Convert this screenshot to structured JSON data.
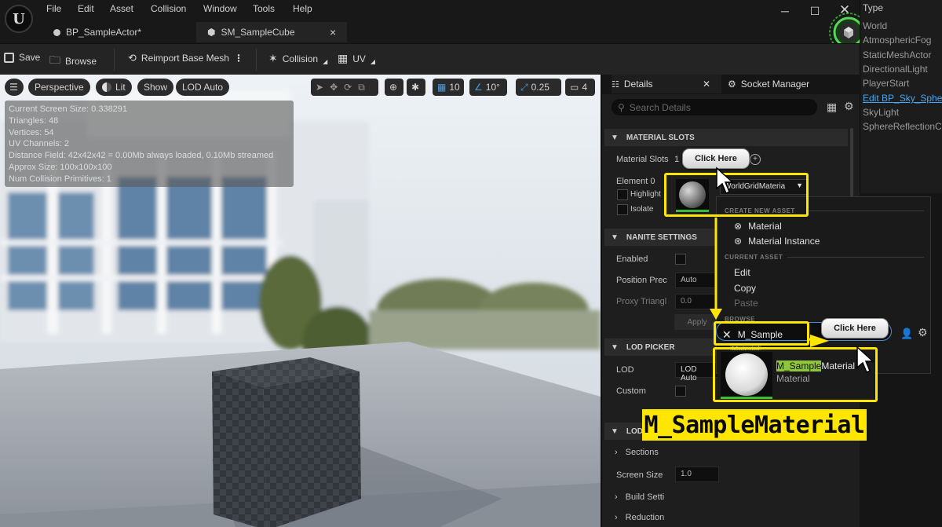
{
  "app": {
    "menu": [
      "File",
      "Edit",
      "Asset",
      "Collision",
      "Window",
      "Tools",
      "Help"
    ],
    "tabs": [
      {
        "label": "BP_SampleActor*"
      },
      {
        "label": "SM_SampleCube"
      }
    ],
    "tab_close": "×"
  },
  "toolbar": {
    "save": "Save",
    "browse": "Browse",
    "reimport": "Reimport Base Mesh",
    "collision": "Collision",
    "uv": "UV"
  },
  "viewport": {
    "perspective": "Perspective",
    "lit": "Lit",
    "show": "Show",
    "lod": "LOD Auto",
    "grid_snap": "10",
    "rot_snap": "10°",
    "scale_snap": "0.25",
    "cam_speed": "4",
    "stats": [
      "Current Screen Size: 0.338291",
      "Triangles: 48",
      "Vertices: 54",
      "UV Channels: 2",
      "Distance Field: 42x42x42 = 0.00Mb always loaded, 0.10Mb streamed",
      "Approx Size: 100x100x100",
      "Num Collision Primitives: 1"
    ]
  },
  "outliner": {
    "header": "Type",
    "items": [
      "World",
      "AtmosphericFog",
      "StaticMeshActor",
      "DirectionalLight",
      "PlayerStart",
      "Edit BP_Sky_Sphere",
      "SkyLight",
      "SphereReflectionCa"
    ]
  },
  "details": {
    "tab_details": "Details",
    "tab_socket": "Socket Manager",
    "search_placeholder": "Search Details",
    "material_slots_header": "MATERIAL SLOTS",
    "material_slots_label": "Material Slots",
    "material_slots_value": "1 M",
    "element0": "Element 0",
    "highlight": "Highlight",
    "isolate": "Isolate",
    "material_name": "WorldGridMateria",
    "nanite_header": "NANITE SETTINGS",
    "enabled": "Enabled",
    "position_prec": "Position Prec",
    "position_prec_value": "Auto",
    "proxy_tri": "Proxy Triangl",
    "proxy_tri_value": "0.0",
    "apply": "Apply",
    "lod_picker_header": "LOD PICKER",
    "lod": "LOD",
    "lod_value": "LOD Auto",
    "custom": "Custom",
    "lod0_header": "LOD",
    "sections": "Sections",
    "screen_size": "Screen Size",
    "screen_size_value": "1.0",
    "build_settings": "Build Setti",
    "reduction": "Reduction"
  },
  "dropdown": {
    "create_new_asset": "CREATE NEW ASSET",
    "material": "Material",
    "material_instance": "Material Instance",
    "current_asset": "CURRENT ASSET",
    "edit": "Edit",
    "copy": "Copy",
    "paste": "Paste",
    "browse": "BROWSE",
    "search_value": "M_Sample",
    "result_type_tag": "Material",
    "result_name_highlight": "M_Sample",
    "result_name_rest": "Material",
    "result_type": "Material"
  },
  "annotations": {
    "click_here_1": "Click Here",
    "click_here_2": "Click Here",
    "big_title": "M_SampleMaterial"
  },
  "colors": {
    "highlight_yellow": "#ffe600",
    "match_green": "#8fc53a",
    "panel_bg": "#1e1e1e"
  }
}
